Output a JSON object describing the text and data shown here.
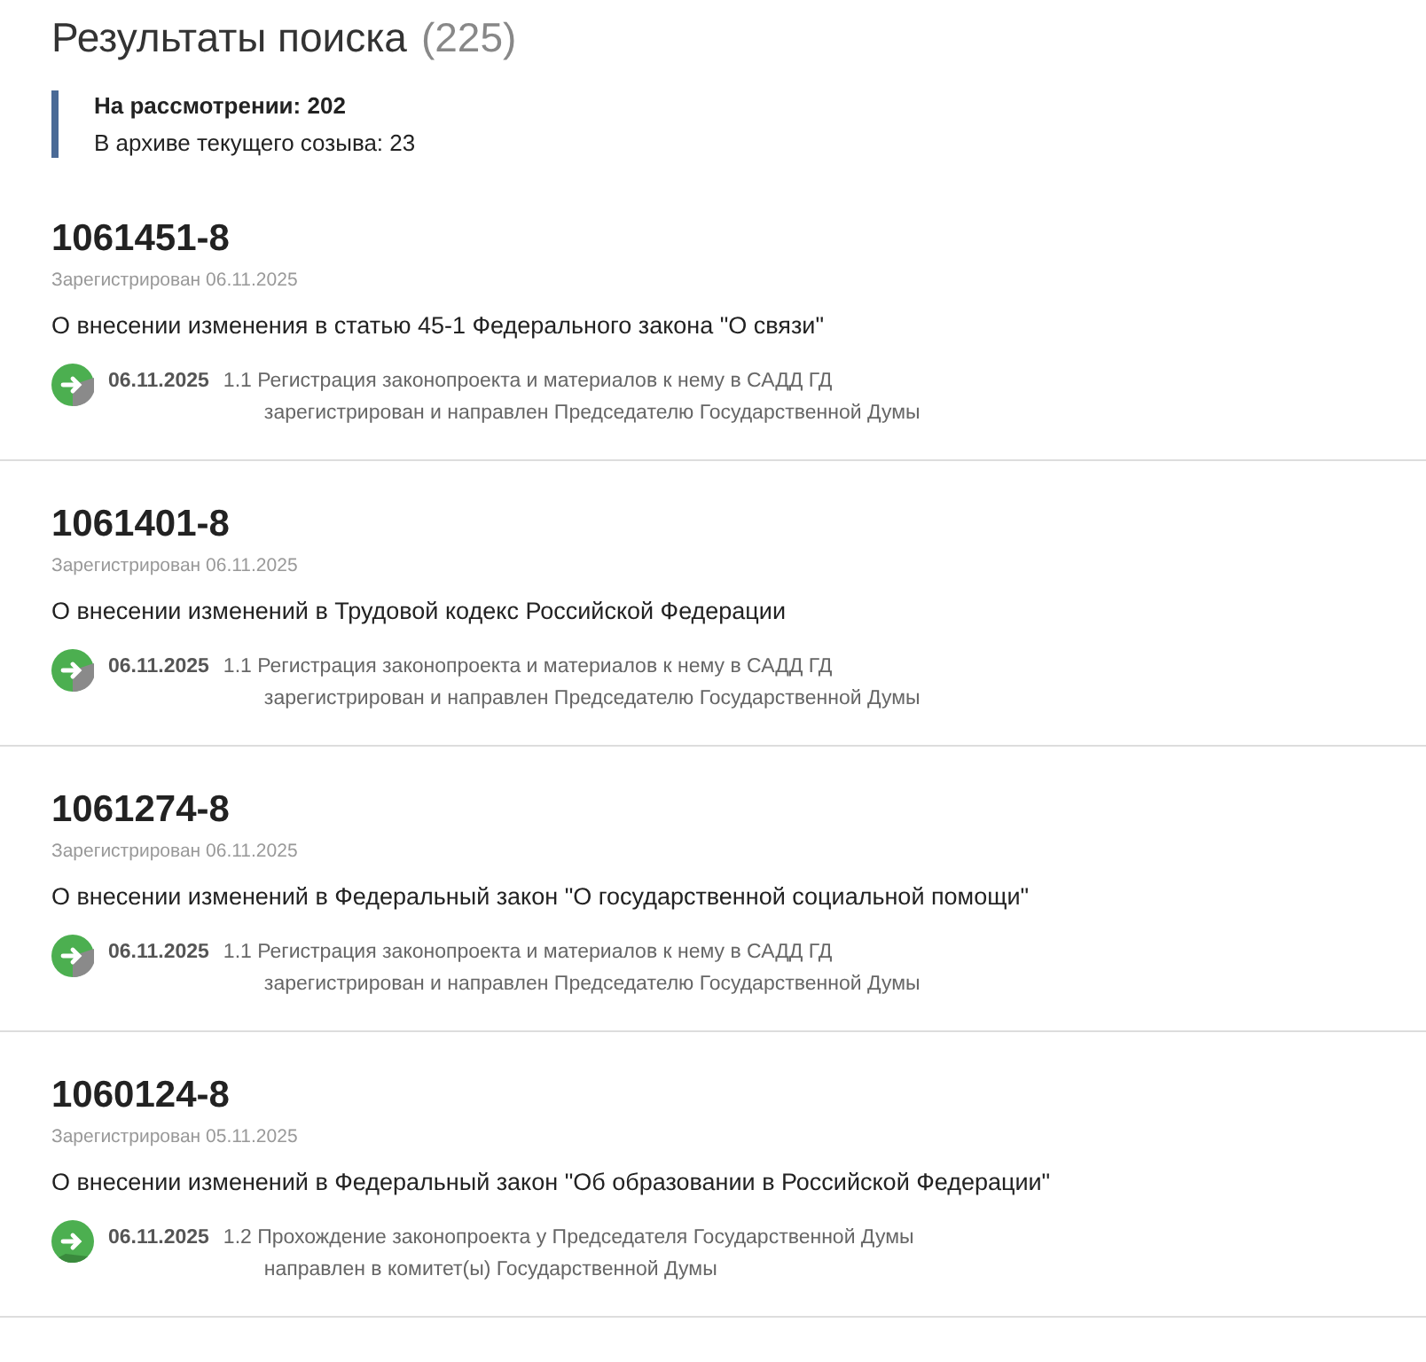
{
  "title": "Результаты поиска",
  "total": "(225)",
  "summary": [
    {
      "label": "На рассмотрении: 202",
      "bold": true
    },
    {
      "label": "В архиве текущего созыва: 23",
      "bold": false
    }
  ],
  "results": [
    {
      "number": "1061451-8",
      "registered": "Зарегистрирован 06.11.2025",
      "name": "О внесении изменения в статью 45-1 Федерального закона \"О связи\"",
      "stage": {
        "date": "06.11.2025",
        "title": "1.1 Регистрация законопроекта и материалов к нему в САДД ГД",
        "decision": "зарегистрирован и направлен Председателю Государственной Думы",
        "complete": false
      }
    },
    {
      "number": "1061401-8",
      "registered": "Зарегистрирован 06.11.2025",
      "name": "О внесении изменений в Трудовой кодекс Российской Федерации",
      "stage": {
        "date": "06.11.2025",
        "title": "1.1 Регистрация законопроекта и материалов к нему в САДД ГД",
        "decision": "зарегистрирован и направлен Председателю Государственной Думы",
        "complete": false
      }
    },
    {
      "number": "1061274-8",
      "registered": "Зарегистрирован 06.11.2025",
      "name": "О внесении изменений в Федеральный закон \"О государственной социальной помощи\"",
      "stage": {
        "date": "06.11.2025",
        "title": "1.1 Регистрация законопроекта и материалов к нему в САДД ГД",
        "decision": "зарегистрирован и направлен Председателю Государственной Думы",
        "complete": false
      }
    },
    {
      "number": "1060124-8",
      "registered": "Зарегистрирован 05.11.2025",
      "name": "О внесении изменений в Федеральный закон \"Об образовании в Российской Федерации\"",
      "stage": {
        "date": "06.11.2025",
        "title": "1.2 Прохождение законопроекта у Председателя Государственной Думы",
        "decision": "направлен в комитет(ы) Государственной Думы",
        "complete": true
      }
    }
  ]
}
